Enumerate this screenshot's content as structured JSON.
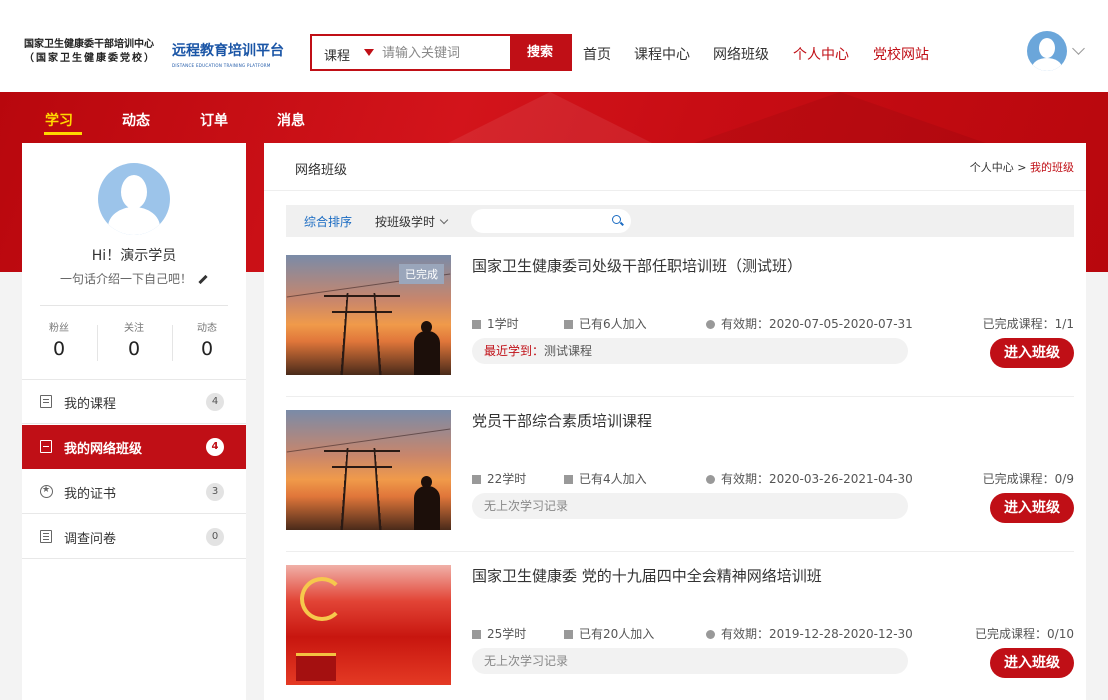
{
  "header": {
    "logo_line1": "国家卫生健康委干部培训中心",
    "logo_line2": "（国家卫生健康委党校）",
    "platform_name": "远程教育培训平台",
    "platform_en": "DISTANCE EDUCATION TRAINING PLATFORM",
    "search": {
      "category": "课程",
      "placeholder": "请输入关键词",
      "button": "搜索"
    },
    "nav": [
      "首页",
      "课程中心",
      "网络班级",
      "个人中心",
      "党校网站"
    ]
  },
  "subnav": [
    "学习",
    "动态",
    "订单",
    "消息"
  ],
  "profile": {
    "greeting": "Hi！演示学员",
    "intro": "一句话介绍一下自己吧！",
    "stats": [
      {
        "label": "粉丝",
        "value": "0"
      },
      {
        "label": "关注",
        "value": "0"
      },
      {
        "label": "动态",
        "value": "0"
      }
    ]
  },
  "menu": [
    {
      "label": "我的课程",
      "count": "4"
    },
    {
      "label": "我的网络班级",
      "count": "4"
    },
    {
      "label": "我的证书",
      "count": "3"
    },
    {
      "label": "调查问卷",
      "count": "0"
    }
  ],
  "main": {
    "title": "网络班级",
    "breadcrumb": {
      "root": "个人中心",
      "sep": " > ",
      "current": "我的班级"
    },
    "filters": {
      "default_sort": "综合排序",
      "hours_sort": "按班级学时"
    },
    "courses": [
      {
        "title": "国家卫生健康委司处级干部任职培训班（测试班）",
        "tag": "已完成",
        "hours": "1学时",
        "joined": "已有6人加入",
        "validity": "有效期：2020-07-05-2020-07-31",
        "recent_label": "最近学到：",
        "recent_value": "测试课程",
        "completed": "已完成课程：1/1",
        "button": "进入班级"
      },
      {
        "title": "党员干部综合素质培训课程",
        "hours": "22学时",
        "joined": "已有4人加入",
        "validity": "有效期：2020-03-26-2021-04-30",
        "recent_text": "无上次学习记录",
        "completed": "已完成课程：0/9",
        "button": "进入班级"
      },
      {
        "title": "国家卫生健康委 党的十九届四中全会精神网络培训班",
        "hours": "25学时",
        "joined": "已有20人加入",
        "validity": "有效期：2019-12-28-2020-12-30",
        "recent_text": "无上次学习记录",
        "completed": "已完成课程：0/10",
        "button": "进入班级"
      }
    ]
  },
  "colors": {
    "brand_red": "#c00f16",
    "link_blue": "#1a6bc2",
    "active_yellow": "#ffd800"
  }
}
